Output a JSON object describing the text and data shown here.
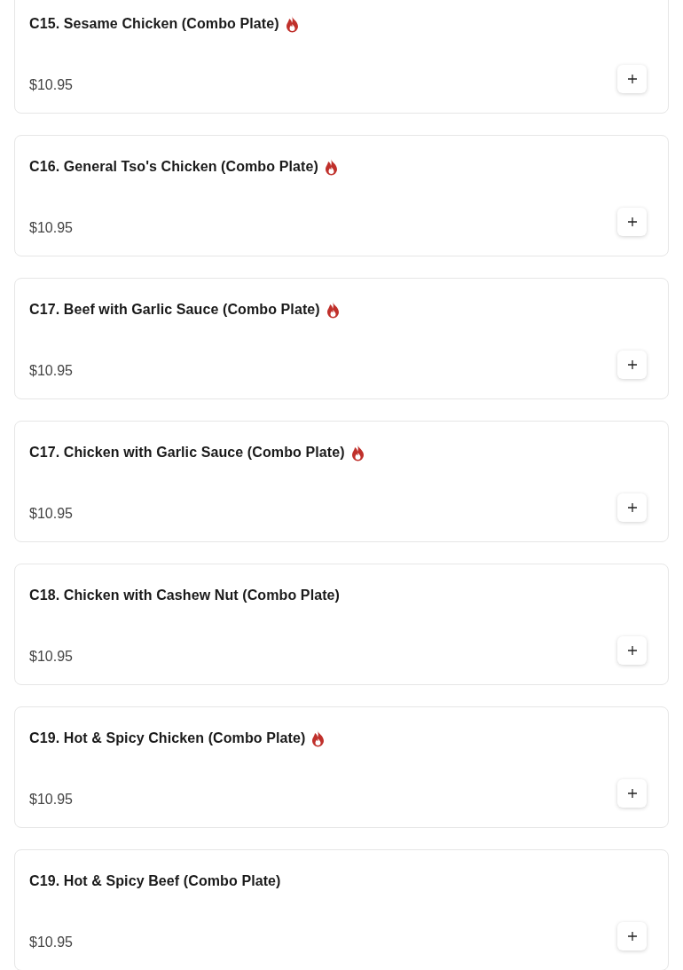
{
  "menu_items": [
    {
      "name": "C15. Sesame Chicken (Combo Plate)",
      "spicy": true,
      "price": "$10.95"
    },
    {
      "name": "C16. General Tso's Chicken (Combo Plate)",
      "spicy": true,
      "price": "$10.95"
    },
    {
      "name": "C17. Beef with Garlic Sauce (Combo Plate)",
      "spicy": true,
      "price": "$10.95"
    },
    {
      "name": "C17. Chicken with Garlic Sauce (Combo Plate)",
      "spicy": true,
      "price": "$10.95"
    },
    {
      "name": "C18. Chicken with Cashew Nut (Combo Plate)",
      "spicy": false,
      "price": "$10.95"
    },
    {
      "name": "C19. Hot & Spicy Chicken (Combo Plate)",
      "spicy": true,
      "price": "$10.95"
    },
    {
      "name": "C19. Hot & Spicy Beef (Combo Plate)",
      "spicy": false,
      "price": "$10.95"
    }
  ]
}
